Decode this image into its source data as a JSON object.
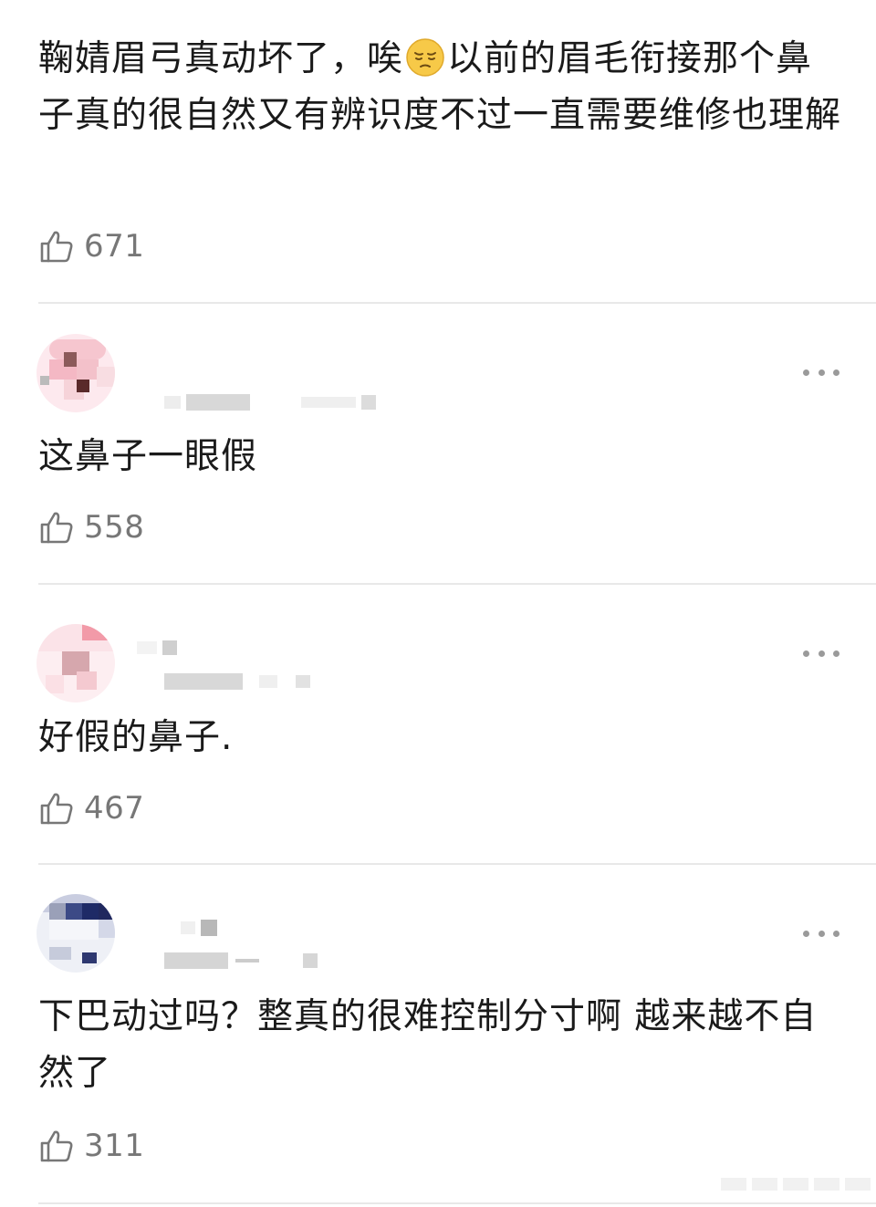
{
  "comments": [
    {
      "text_before_emoji": "鞠婧眉弓真动坏了，唉",
      "emoji": "pensive-face-emoji",
      "text_after_emoji": "以前的眉毛衔接那个鼻子真的很自然又有辨识度不过一直需要维修也理解",
      "likes": "671"
    },
    {
      "text": "这鼻子一眼假",
      "likes": "558"
    },
    {
      "text": "好假的鼻子.",
      "likes": "467"
    },
    {
      "text": "下巴动过吗？整真的很难控制分寸啊 越来越不自然了",
      "likes": "311"
    }
  ],
  "icons": {
    "like": "thumbs-up-icon",
    "more": "more-dots-icon"
  },
  "colors": {
    "text": "#1a1a1a",
    "like_count": "#777777",
    "divider": "#e8e8e8",
    "more_dots": "#9a9a9a"
  }
}
